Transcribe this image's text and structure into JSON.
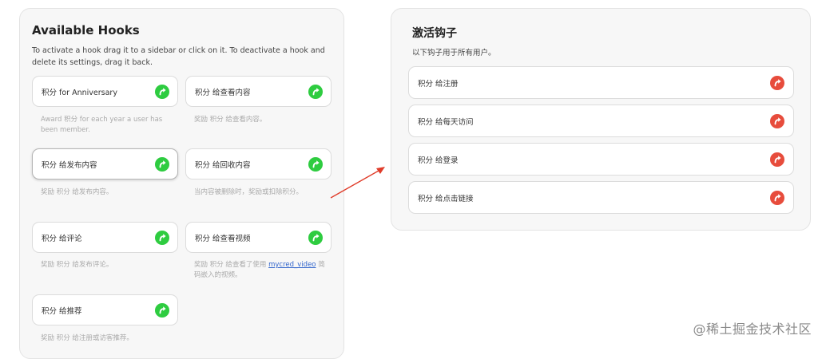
{
  "available": {
    "title": "Available Hooks",
    "description": "To activate a hook drag it to a sidebar or click on it. To deactivate a hook and delete its settings, drag it back.",
    "hooks": [
      {
        "label": "积分 for Anniversary",
        "desc": "Award 积分 for each year a user has been member."
      },
      {
        "label": "积分 给查看内容",
        "desc": "奖励 积分 给查看内容。"
      },
      {
        "label": "积分 给发布内容",
        "desc": "奖励 积分 给发布内容。"
      },
      {
        "label": "积分 给回收内容",
        "desc": "当内容被删除时，奖励或扣除积分。"
      },
      {
        "label": "积分 给评论",
        "desc": "奖励 积分 给发布评论。"
      },
      {
        "label": "积分 给查看视频",
        "desc_pre": "奖励 积分 给查看了使用 ",
        "desc_link": "mycred_video",
        "desc_post": " 简码嵌入的视频。"
      },
      {
        "label": "积分 给推荐",
        "desc": "奖励 积分 给注册或访客推荐。"
      }
    ]
  },
  "active": {
    "title": "激活钩子",
    "description": "以下钩子用于所有用户。",
    "hooks": [
      {
        "label": "积分 给注册"
      },
      {
        "label": "积分 给每天访问"
      },
      {
        "label": "积分 给登录"
      },
      {
        "label": "积分 给点击链接"
      }
    ]
  },
  "colors": {
    "activate": "#2ecc40",
    "deactivate": "#e74c3c",
    "arrow": "#e03c2a"
  },
  "icons": {
    "activate": "activate-arrow-icon",
    "deactivate": "deactivate-arrow-icon"
  },
  "watermark": "@稀土掘金技术社区"
}
